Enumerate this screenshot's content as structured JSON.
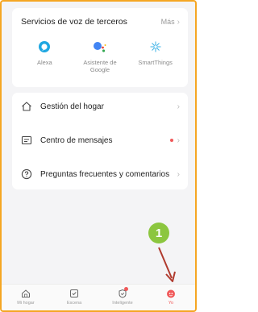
{
  "voice_services": {
    "title": "Servicios de voz de terceros",
    "more_label": "Más",
    "items": [
      {
        "label": "Alexa",
        "icon": "alexa-icon"
      },
      {
        "label": "Asistente de Google",
        "icon": "google-assistant-icon"
      },
      {
        "label": "SmartThings",
        "icon": "smartthings-icon"
      }
    ]
  },
  "menu": {
    "items": [
      {
        "label": "Gestión del hogar",
        "icon": "home-icon"
      },
      {
        "label": "Centro de mensajes",
        "icon": "message-icon",
        "has_notification": true
      },
      {
        "label": "Preguntas frecuentes y comentarios",
        "icon": "question-icon"
      }
    ]
  },
  "tabbar": {
    "items": [
      {
        "label": "Mi hogar",
        "icon": "home-tab-icon"
      },
      {
        "label": "Escena",
        "icon": "scene-icon"
      },
      {
        "label": "Inteligente",
        "icon": "smart-icon",
        "has_badge": true
      },
      {
        "label": "Yo",
        "icon": "me-icon",
        "active": true
      }
    ]
  },
  "annotation": {
    "number": "1"
  },
  "colors": {
    "accent": "#f0595a",
    "callout": "#8cc63f",
    "frame_border": "#f5a623",
    "arrow": "#b03a2e"
  }
}
